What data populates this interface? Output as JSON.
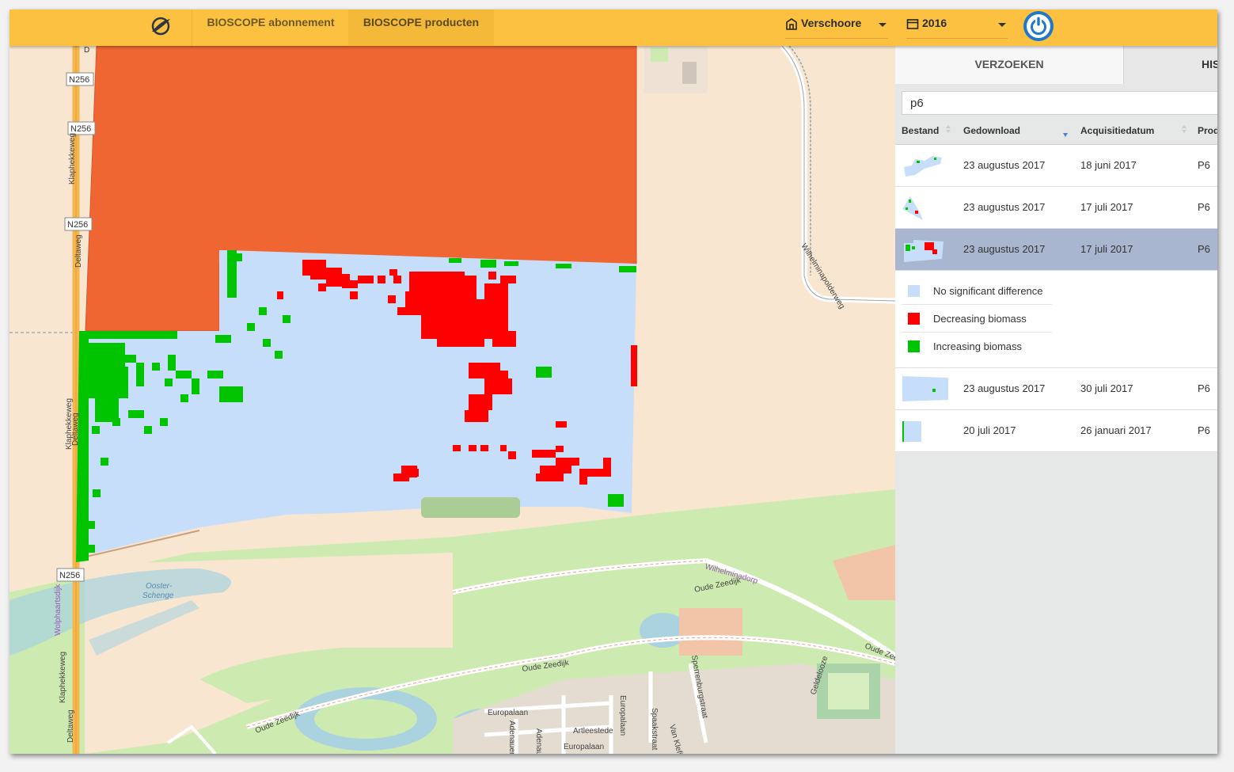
{
  "nav": {
    "tab_abonnement": "BIOSCOPE abonnement",
    "tab_producten": "BIOSCOPE producten",
    "farm": "Verschoore",
    "year": "2016"
  },
  "panel": {
    "tabs": [
      "VERZOEKEN",
      "HIS"
    ],
    "search_value": "p6",
    "columns": [
      "Bestand",
      "Gedownload",
      "Acquisitiedatum",
      "Prod"
    ],
    "rows": [
      {
        "downloaded": "23 augustus 2017",
        "acquired": "18 juni 2017",
        "product": "P6",
        "selected": false
      },
      {
        "downloaded": "23 augustus 2017",
        "acquired": "17 juli 2017",
        "product": "P6",
        "selected": false
      },
      {
        "downloaded": "23 augustus 2017",
        "acquired": "17 juli 2017",
        "product": "P6",
        "selected": true
      },
      {
        "downloaded": "23 augustus 2017",
        "acquired": "30 juli 2017",
        "product": "P6",
        "selected": false
      },
      {
        "downloaded": "20 juli 2017",
        "acquired": "26 januari 2017",
        "product": "P6",
        "selected": false
      }
    ],
    "legend": [
      {
        "label": "No significant difference",
        "color": "#c7defa"
      },
      {
        "label": "Decreasing biomass",
        "color": "#ff0000"
      },
      {
        "label": "Increasing biomass",
        "color": "#00c400"
      }
    ]
  },
  "map": {
    "labels": {
      "n256": "N256",
      "klaphekkeweg": "Klaphekkeweg",
      "deltaweg": "Deltaweg",
      "wilhelminapolderweg": "Wilhelminapolderweg",
      "wilhelminadorp": "Wilhelminadorp",
      "oude_zeedijk": "Oude Zeedijk",
      "ooster_schenge": "Ooster-",
      "ooster_schenge2": "Schenge",
      "wolphaartsdijk": "Wolphaartsdijk",
      "europalaan": "Europalaan",
      "spaakstraat": "Spaakstraat",
      "sperrenburgstraat": "Sperrenburgstraat",
      "artleestede": "Artleestede",
      "adenauerhof": "Adenauerho",
      "van_kleffens": "Van Klefi",
      "geldeloozeweg": "Geldelooze",
      "oude_zee": "Oude Zee",
      "d_label": "D"
    },
    "colors": {
      "orange_field": "#f06633",
      "no_diff": "#c7defa",
      "decrease": "#ff0000",
      "increase": "#00c400",
      "farmland": "#f9e6d0",
      "grass": "#cdebb0",
      "road": "#f7b64b"
    }
  }
}
